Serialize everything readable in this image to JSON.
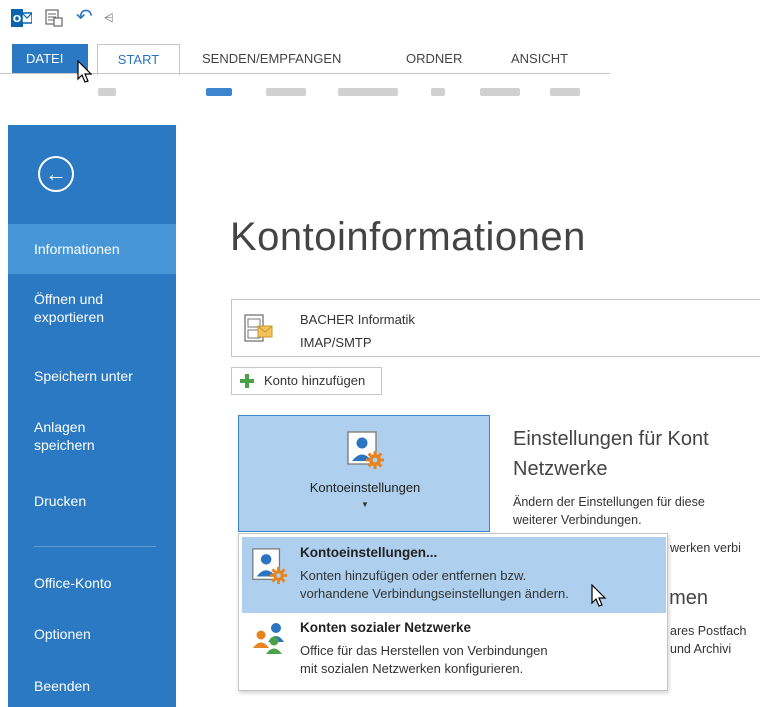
{
  "ribbon": {
    "tabs": {
      "file": "DATEI",
      "start": "START",
      "send": "SENDEN/EMPFANGEN",
      "folder": "ORDNER",
      "view": "ANSICHT"
    }
  },
  "nav": {
    "back_icon": "back-arrow-circle-icon",
    "items": [
      {
        "label": "Informationen"
      },
      {
        "label": "Öffnen und exportieren"
      },
      {
        "label": "Speichern unter"
      },
      {
        "label": "Anlagen speichern"
      },
      {
        "label": "Drucken"
      },
      {
        "label": "Office-Konto"
      },
      {
        "label": "Optionen"
      },
      {
        "label": "Beenden"
      }
    ]
  },
  "main": {
    "title": "Kontoinformationen",
    "account": {
      "name": "BACHER Informatik",
      "type": "IMAP/SMTP"
    },
    "add_account_label": "Konto hinzufügen",
    "settings_button_label": "Kontoeinstellungen",
    "settings_section": {
      "title": "Einstellungen für Kont\nNetzwerke",
      "text": "Ändern der Einstellungen für diese\nweiterer Verbindungen.",
      "fragment_1": "werken verbi",
      "title2": "umen",
      "fragment_2": "ares Postfach",
      "fragment_3": "und Archivi"
    }
  },
  "menu": {
    "items": [
      {
        "title": "Kontoeinstellungen...",
        "description": "Konten hinzufügen oder entfernen bzw.\nvorhandene Verbindungseinstellungen ändern."
      },
      {
        "title": "Konten sozialer Netzwerke",
        "description": "Office für das Herstellen von Verbindungen\nmit sozialen Netzwerken konfigurieren."
      }
    ]
  },
  "colors": {
    "accent": "#2b79c2",
    "nav_active": "#4796d7",
    "hover": "#aed0ee"
  }
}
